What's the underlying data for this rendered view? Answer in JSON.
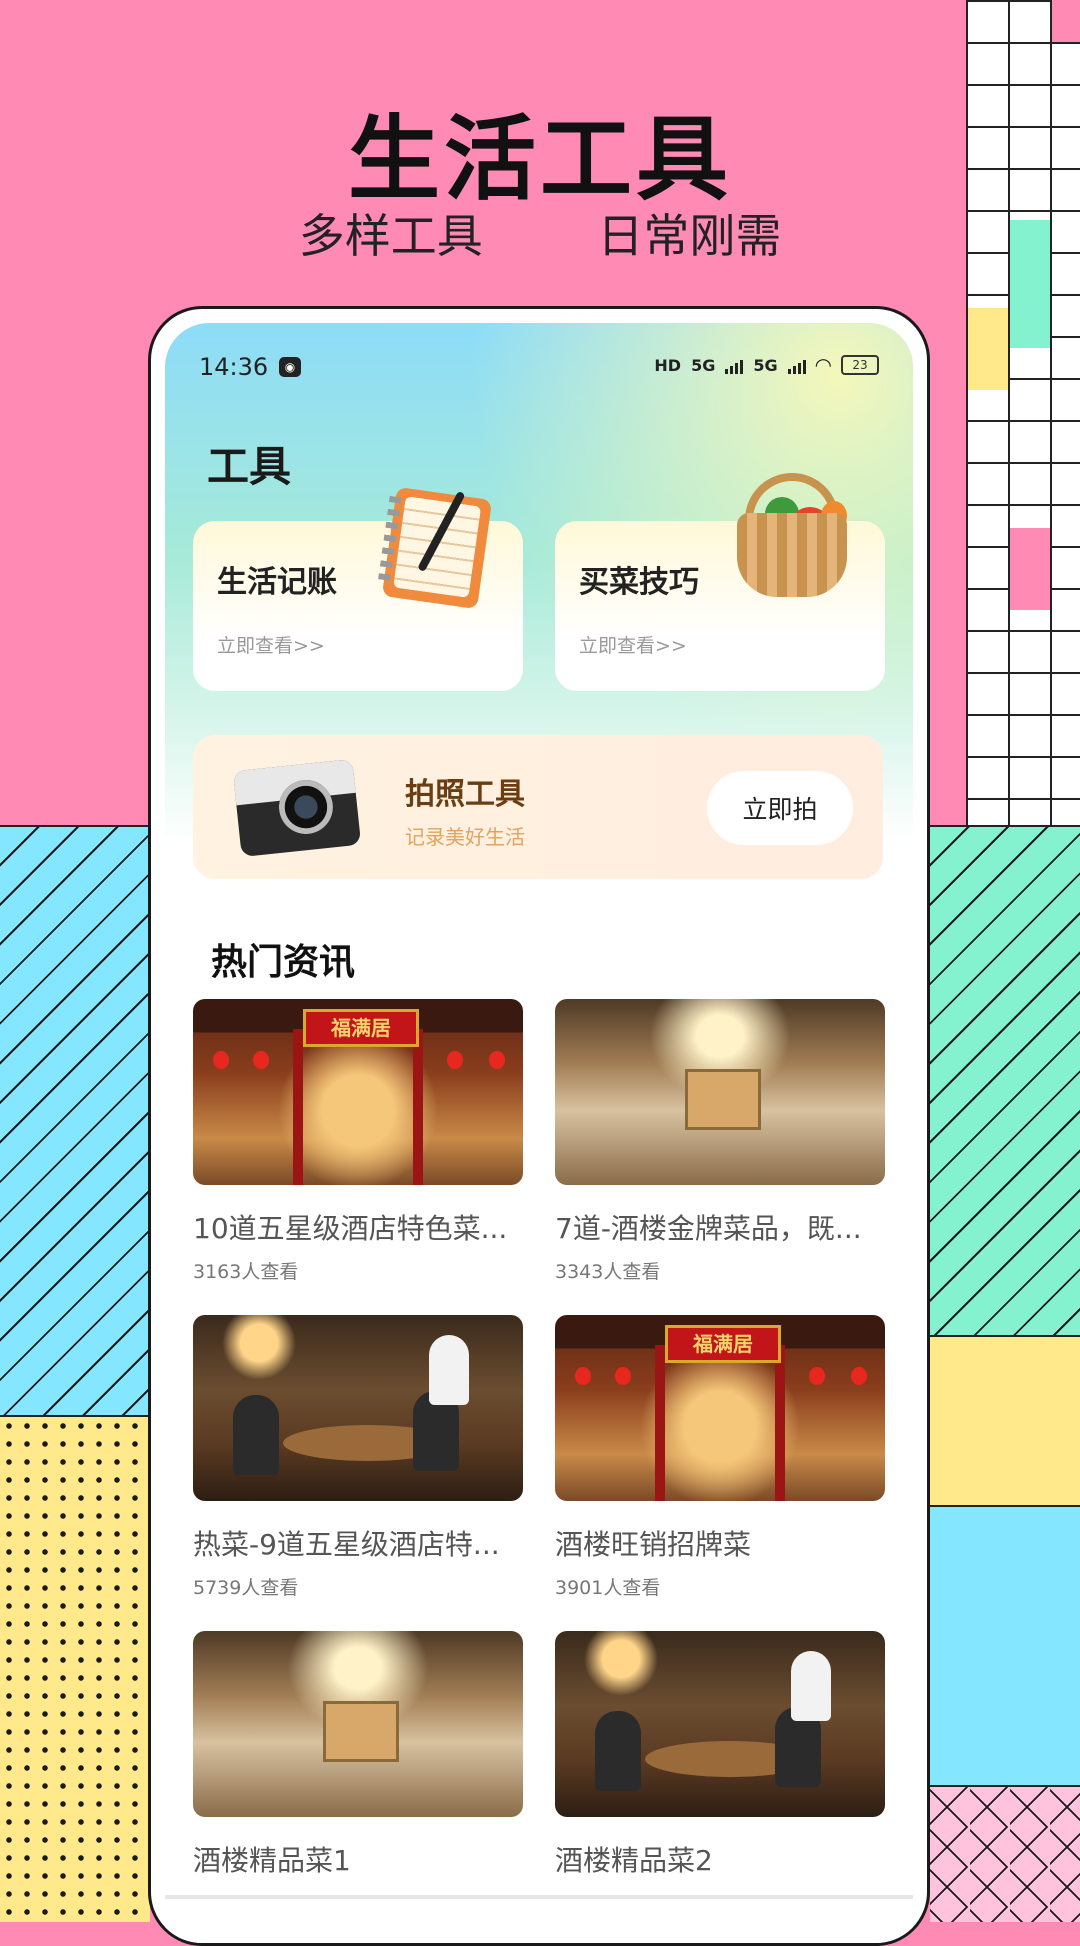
{
  "banner": {
    "title": "生活工具",
    "subtitle_left": "多样工具",
    "subtitle_right": "日常刚需"
  },
  "status_bar": {
    "time": "14:36",
    "network_1": "5G",
    "network_2": "5G",
    "hd_label": "HD",
    "battery": "23"
  },
  "page": {
    "title": "工具"
  },
  "tools": [
    {
      "name": "生活记账",
      "link": "立即查看>>",
      "icon": "notebook-pen-icon"
    },
    {
      "name": "买菜技巧",
      "link": "立即查看>>",
      "icon": "vegetable-basket-icon"
    }
  ],
  "photo_tool": {
    "title": "拍照工具",
    "subtitle": "记录美好生活",
    "button": "立即拍",
    "icon": "camera-icon"
  },
  "news": {
    "section_title": "热门资讯",
    "items": [
      {
        "title": "10道五星级酒店特色菜...",
        "views": "3163人查看"
      },
      {
        "title": "7道-酒楼金牌菜品，既...",
        "views": "3343人查看"
      },
      {
        "title": "热菜-9道五星级酒店特...",
        "views": "5739人查看"
      },
      {
        "title": "酒楼旺销招牌菜",
        "views": "3901人查看"
      },
      {
        "title": "酒楼精品菜1",
        "views": ""
      },
      {
        "title": "酒楼精品菜2",
        "views": ""
      }
    ],
    "sign_text": "福满居"
  },
  "colors": {
    "background_pink": "#FF8AB3",
    "accent_brown": "#6A3E12",
    "accent_orange": "#E0A45F"
  }
}
